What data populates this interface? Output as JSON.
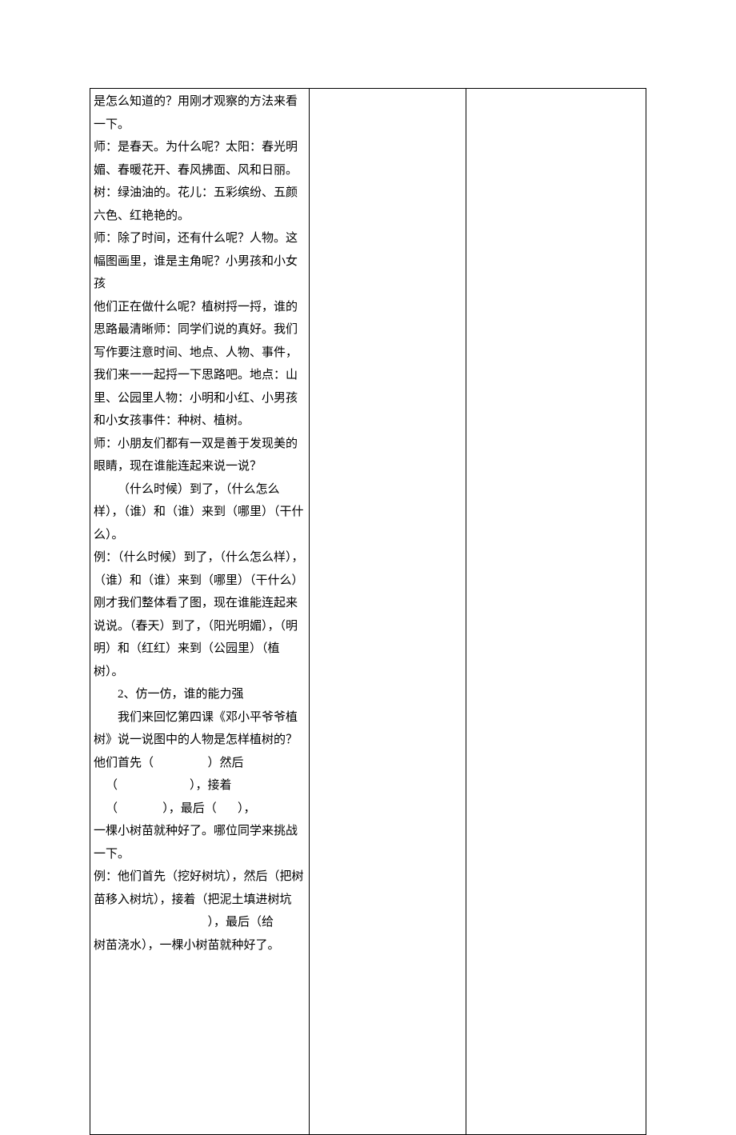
{
  "doc": {
    "p1": "是怎么知道的？用刚才观察的方法来看一下。",
    "p2": "师：是春天。为什么呢？太阳：春光明媚、春暖花开、春风拂面、风和日丽。树：绿油油的。花儿：五彩缤纷、五颜六色、红艳艳的。",
    "p3": "师：除了时间，还有什么呢？人物。这幅图画里，谁是主角呢？小男孩和小女孩",
    "p4": "他们正在做什么呢？植树捋一捋，谁的思路最清晰师：同学们说的真好。我们写作要注意时间、地点、人物、事件，我们来一一起捋一下思路吧。地点：山里、公园里人物：小明和小红、小男孩和小女孩事件：种树、植树。",
    "p5": "师：小朋友们都有一双是善于发现美的眼睛，现在谁能连起来说一说？",
    "p6": "（什么时候）到了，（什么怎么样），（谁）和（谁）来到（哪里）（干什么）。",
    "p7": "例：（什么时候）到了，（什么怎么样），（谁）和（谁）来到（哪里）（干什么）",
    "p8": "刚才我们整体看了图，现在谁能连起来说说。（春天）到了，（阳光明媚），（明明）和（红红）来到（公园里）（植树）。",
    "p9": "2、仿一仿，谁的能力强",
    "p10": "我们来回忆第四课《邓小平爷爷植树》说一说图中的人物是怎样植树的？",
    "p11a": "他们首先（",
    "p11b": "）然后",
    "p12a": "（",
    "p12b": "），接着",
    "p13a": "（",
    "p13b": "），最后（",
    "p13c": "），",
    "p14": "一棵小树苗就种好了。哪位同学来挑战一下。",
    "p15": "例：他们首先（挖好树坑），然后（把树苗移入树坑），接着（把泥土填进树坑",
    "p16": "），最后（给",
    "p17": "树苗浇水），一棵小树苗就种好了。"
  }
}
